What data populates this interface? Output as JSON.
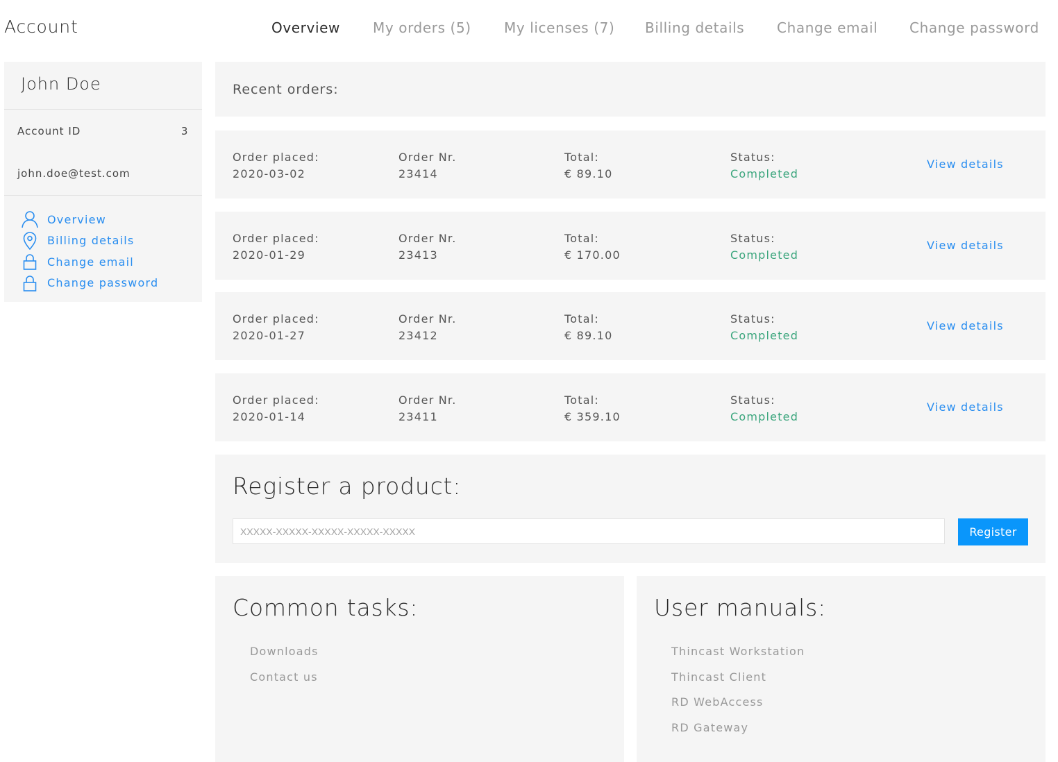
{
  "header": {
    "title": "Account",
    "tabs": [
      {
        "label": "Overview",
        "active": true
      },
      {
        "label": "My orders (5)",
        "active": false
      },
      {
        "label": "My licenses (7)",
        "active": false
      },
      {
        "label": "Billing details",
        "active": false
      },
      {
        "label": "Change email",
        "active": false
      },
      {
        "label": "Change password",
        "active": false
      }
    ]
  },
  "sidebar": {
    "name": "John Doe",
    "account_id_label": "Account ID",
    "account_id": "3",
    "email": "john.doe@test.com",
    "nav": [
      {
        "label": "Overview",
        "icon": "user-icon"
      },
      {
        "label": "Billing details",
        "icon": "location-pin-icon"
      },
      {
        "label": "Change email",
        "icon": "lock-icon"
      },
      {
        "label": "Change password",
        "icon": "lock-icon"
      }
    ]
  },
  "orders": {
    "title": "Recent orders:",
    "labels": {
      "placed": "Order placed:",
      "number": "Order Nr.",
      "total": "Total:",
      "status": "Status:",
      "view": "View details"
    },
    "rows": [
      {
        "placed": "2020-03-02",
        "number": "23414",
        "total": "€ 89.10",
        "status": "Completed"
      },
      {
        "placed": "2020-01-29",
        "number": "23413",
        "total": "€ 170.00",
        "status": "Completed"
      },
      {
        "placed": "2020-01-27",
        "number": "23412",
        "total": "€ 89.10",
        "status": "Completed"
      },
      {
        "placed": "2020-01-14",
        "number": "23411",
        "total": "€ 359.10",
        "status": "Completed"
      }
    ]
  },
  "register": {
    "title": "Register a product:",
    "placeholder": "XXXXX-XXXXX-XXXXX-XXXXX-XXXXX",
    "value": "",
    "button": "Register"
  },
  "common_tasks": {
    "title": "Common tasks:",
    "items": [
      "Downloads",
      "Contact us"
    ]
  },
  "user_manuals": {
    "title": "User manuals:",
    "items": [
      "Thincast Workstation",
      "Thincast Client",
      "RD WebAccess",
      "RD Gateway"
    ]
  },
  "colors": {
    "accent": "#0a96fb",
    "link": "#2a8ef0",
    "status_completed": "#3aa57c",
    "panel_bg": "#f5f5f5"
  }
}
